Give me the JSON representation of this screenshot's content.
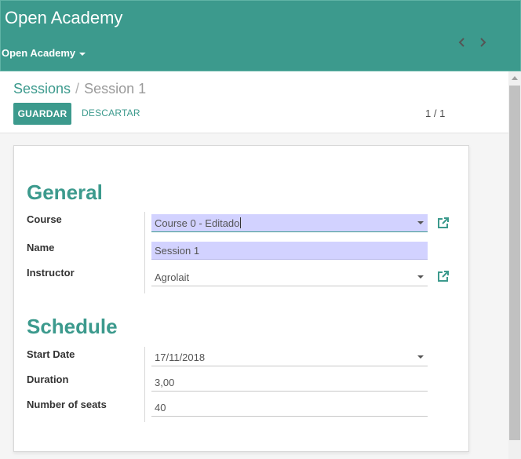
{
  "header": {
    "app_title": "Open Academy"
  },
  "menu": {
    "root_label": "Open Academy"
  },
  "breadcrumb": {
    "parent": "Sessions",
    "separator": "/",
    "current": "Session 1"
  },
  "toolbar": {
    "save_label": "GUARDAR",
    "discard_label": "DESCARTAR"
  },
  "pager": {
    "text": "1 / 1"
  },
  "form": {
    "general": {
      "title": "General",
      "course_label": "Course",
      "course_value": "Course 0 - Editado",
      "name_label": "Name",
      "name_value": "Session 1",
      "instructor_label": "Instructor",
      "instructor_value": "Agrolait"
    },
    "schedule": {
      "title": "Schedule",
      "start_date_label": "Start Date",
      "start_date_value": "17/11/2018",
      "duration_label": "Duration",
      "duration_value": "3,00",
      "seats_label": "Number of seats",
      "seats_value": "40"
    }
  },
  "icons": {
    "menu_caret": "caret-down-icon",
    "pager_prev": "chevron-left-icon",
    "pager_next": "chevron-right-icon",
    "external": "external-link-icon",
    "dropdown": "caret-down-icon"
  },
  "colors": {
    "brand": "#3c9a8d",
    "required_field": "#d2d2ff",
    "background": "#f5f5f5"
  }
}
